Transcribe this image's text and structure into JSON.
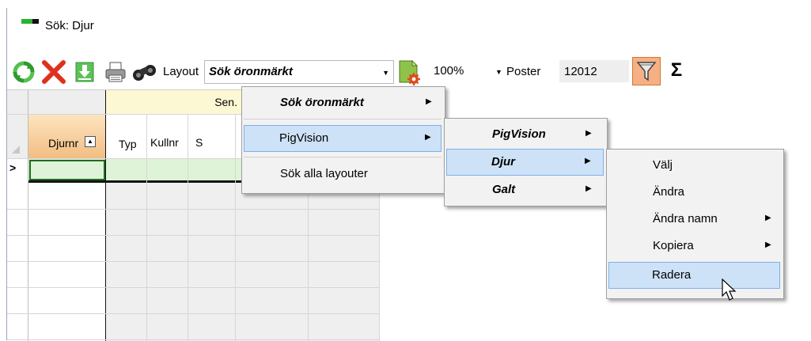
{
  "window": {
    "title": "Sök: Djur"
  },
  "toolbar": {
    "layout_label": "Layout",
    "layout_value": "Sök öronmärkt",
    "zoom_value": "100%",
    "poster_label": "Poster",
    "poster_value": "12012",
    "sigma": "Σ",
    "icons": [
      "refresh-icon",
      "delete-icon",
      "download-icon",
      "print-icon",
      "binoculars-icon",
      "gear-document-icon",
      "filter-icon",
      "sigma-icon"
    ]
  },
  "grid": {
    "group_header": "Sen.",
    "columns": [
      "Djurnr",
      "Typ",
      "Kullnr",
      "S"
    ],
    "row_pointer": ">",
    "sort_indicator": "▲"
  },
  "menus": {
    "level1": {
      "items": [
        {
          "label": "Sök öronmärkt",
          "has_submenu": true
        },
        {
          "label": "PigVision",
          "has_submenu": true
        },
        {
          "label": "Sök alla layouter",
          "has_submenu": false
        }
      ]
    },
    "level2": {
      "items": [
        {
          "label": "PigVision",
          "has_submenu": true
        },
        {
          "label": "Djur",
          "has_submenu": true
        },
        {
          "label": "Galt",
          "has_submenu": true
        }
      ]
    },
    "level3": {
      "items": [
        {
          "label": "Välj",
          "has_submenu": false
        },
        {
          "label": "Ändra",
          "has_submenu": false
        },
        {
          "label": "Ändra namn",
          "has_submenu": true
        },
        {
          "label": "Kopiera",
          "has_submenu": true
        },
        {
          "label": "Radera",
          "has_submenu": false
        }
      ]
    },
    "arrow": "▶"
  },
  "colors": {
    "highlight": "#cde2f7",
    "group_header": "#fdf8d4",
    "sorted_header": "#f5c88c",
    "new_row": "#dff3d8",
    "filter_active": "#f6b083"
  }
}
